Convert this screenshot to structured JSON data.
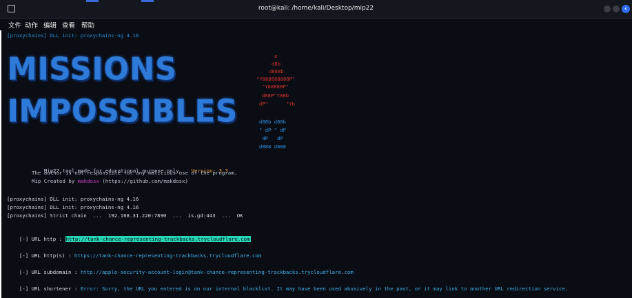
{
  "window": {
    "title": "root@kali: /home/kali/Desktop/mip22"
  },
  "menu": {
    "items": [
      "文件",
      "动作",
      "编辑",
      "查看",
      "帮助"
    ]
  },
  "terminal": {
    "first_line": "[proxychains] DLL init: proxychains-ng 4.16",
    "logo_line1": "MISSIONS",
    "logo_line2": "IMPOSSIBLES",
    "ascii_red": [
      "o",
      "d8b",
      "d888b",
      "\"Y888888888P\"",
      "\"Y88888P\"",
      "d88P\"Y88b",
      "dP\"      \"Yb"
    ],
    "ascii_blue": [
      "d88b d88b",
      "\" dP \" dP",
      " dP   dP",
      "d888 d888"
    ],
    "info": {
      "line1_text": "Mip22 tool made for educational purpose only.",
      "line1_version": "Version: 3.3",
      "line2": "The author is not responsible for any malicious use of the program.",
      "line3_prefix": "Mip Created by ",
      "line3_author": "makdosx",
      "line3_suffix": " (https://github.com/makdosx)"
    },
    "proxy_lines": [
      "[proxychains] DLL init: proxychains-ng 4.16",
      "[proxychains] DLL init: proxychains-ng 4.16",
      "[proxychains] Strict chain  ...  192.168.31.220:7890  ...  is.gd:443  ...  OK"
    ],
    "url_http_label": "[-] URL http : ",
    "url_http_value": "http://tank-chance-representing-trackbacks.trycloudflare.com",
    "url_https_label": "[-] URL http(s) : ",
    "url_https_value": "https://tank-chance-representing-trackbacks.trycloudflare.com",
    "url_sub_label": "[-] URL subdomain : ",
    "url_sub_value": "http://apple-security-account-login@tank-chance-representing-trackbacks.trycloudflare.com",
    "url_short_label": "[-] URL shortener : ",
    "url_short_value": "Error: Sorry, the URL you entered is on our internal blacklist. It may have been used abusively in the past, or it may link to another URL redirection service."
  },
  "colors": {
    "logo": "#2e7ad8",
    "ascii_red": "#d8312c",
    "ascii_blue": "#2f8fe0",
    "highlight": "#27d6b6",
    "accent": "#2f6df0"
  }
}
